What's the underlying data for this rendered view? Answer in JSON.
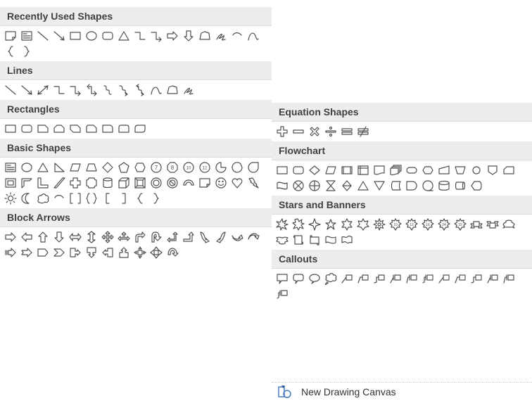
{
  "left_sections": [
    {
      "title": "Recently Used Shapes",
      "shapes": [
        "rect-fold",
        "textbox",
        "line",
        "arrow",
        "rect",
        "oval",
        "rounded-rect",
        "triangle",
        "elbow",
        "elbow-arrow",
        "right-arrow",
        "down-arrow",
        "freeform",
        "scribble",
        "arc",
        "curve",
        "left-brace",
        "right-brace"
      ]
    },
    {
      "title": "Lines",
      "shapes": [
        "line",
        "arrow",
        "double-arrow",
        "elbow",
        "elbow-arrow",
        "elbow-double",
        "curve-connector",
        "curve-arrow",
        "curve-double",
        "curve",
        "freeform",
        "scribble"
      ]
    },
    {
      "title": "Rectangles",
      "shapes": [
        "rect",
        "rounded-rect",
        "snip1",
        "snip2",
        "snip-diag",
        "snip-round",
        "round1",
        "round2",
        "round-diag"
      ]
    },
    {
      "title": "Basic Shapes",
      "shapes": [
        "textbox",
        "oval",
        "triangle",
        "right-triangle",
        "parallelogram",
        "trapezoid",
        "diamond",
        "pentagon",
        "hexagon",
        "heptagon",
        "octagon",
        "decagon",
        "dodecagon",
        "pie",
        "chord",
        "teardrop",
        "frame",
        "half-frame",
        "l-shape",
        "diag-stripe",
        "cross",
        "plaque",
        "can",
        "cube",
        "bevel",
        "donut",
        "no-symbol",
        "block-arc",
        "folded-corner",
        "smiley",
        "heart",
        "lightning",
        "sun",
        "moon",
        "cloud",
        "arc",
        "double-bracket",
        "double-brace",
        "left-bracket",
        "right-bracket",
        "left-brace",
        "right-brace"
      ]
    },
    {
      "title": "Block Arrows",
      "shapes": [
        "right-arrow",
        "left-arrow",
        "up-arrow",
        "down-arrow",
        "left-right-arrow",
        "up-down-arrow",
        "quad-arrow",
        "left-right-up-arrow",
        "bent-arrow",
        "u-turn-arrow",
        "left-up-arrow",
        "bent-up-arrow",
        "curved-right-arrow",
        "curved-left-arrow",
        "curved-up-arrow",
        "curved-down-arrow",
        "striped-arrow",
        "notched-arrow",
        "pentagon-arrow",
        "chevron",
        "right-callout",
        "down-callout",
        "left-callout",
        "up-callout",
        "quad-callout",
        "quad-star-callout",
        "circular-arrow"
      ]
    }
  ],
  "right_sections": [
    {
      "title": "Equation Shapes",
      "shapes": [
        "plus",
        "minus",
        "multiply",
        "divide",
        "equal",
        "not-equal"
      ]
    },
    {
      "title": "Flowchart",
      "shapes": [
        "process",
        "alt-process",
        "decision",
        "data",
        "predefined",
        "internal-storage",
        "document",
        "multidocument",
        "terminator",
        "preparation",
        "manual-input",
        "manual-operation",
        "connector",
        "offpage",
        "card",
        "punched-tape",
        "summing",
        "or",
        "collate",
        "sort",
        "extract",
        "merge",
        "stored-data",
        "delay",
        "seq-storage",
        "magnetic-disk",
        "direct-storage",
        "display"
      ]
    },
    {
      "title": "Stars and Banners",
      "shapes": [
        "explosion1",
        "explosion2",
        "star4",
        "star5",
        "star6",
        "star7",
        "star8",
        "star10",
        "star12",
        "star16",
        "star24",
        "star32",
        "ribbon-up",
        "ribbon-down",
        "curved-ribbon-up",
        "curved-ribbon-down",
        "scroll-v",
        "scroll-h",
        "wave",
        "double-wave"
      ]
    },
    {
      "title": "Callouts",
      "shapes": [
        "rect-callout",
        "rounded-callout",
        "oval-callout",
        "cloud-callout",
        "line-callout1",
        "line-callout2",
        "line-callout3",
        "line-callout4",
        "line-callout5",
        "line-callout6",
        "line-callout7",
        "line-callout8",
        "line-callout9",
        "line-callout10",
        "line-callout11",
        "line-callout12"
      ]
    }
  ],
  "new_canvas": {
    "label": "New Drawing Canvas",
    "icon": "new-drawing-canvas-icon"
  }
}
